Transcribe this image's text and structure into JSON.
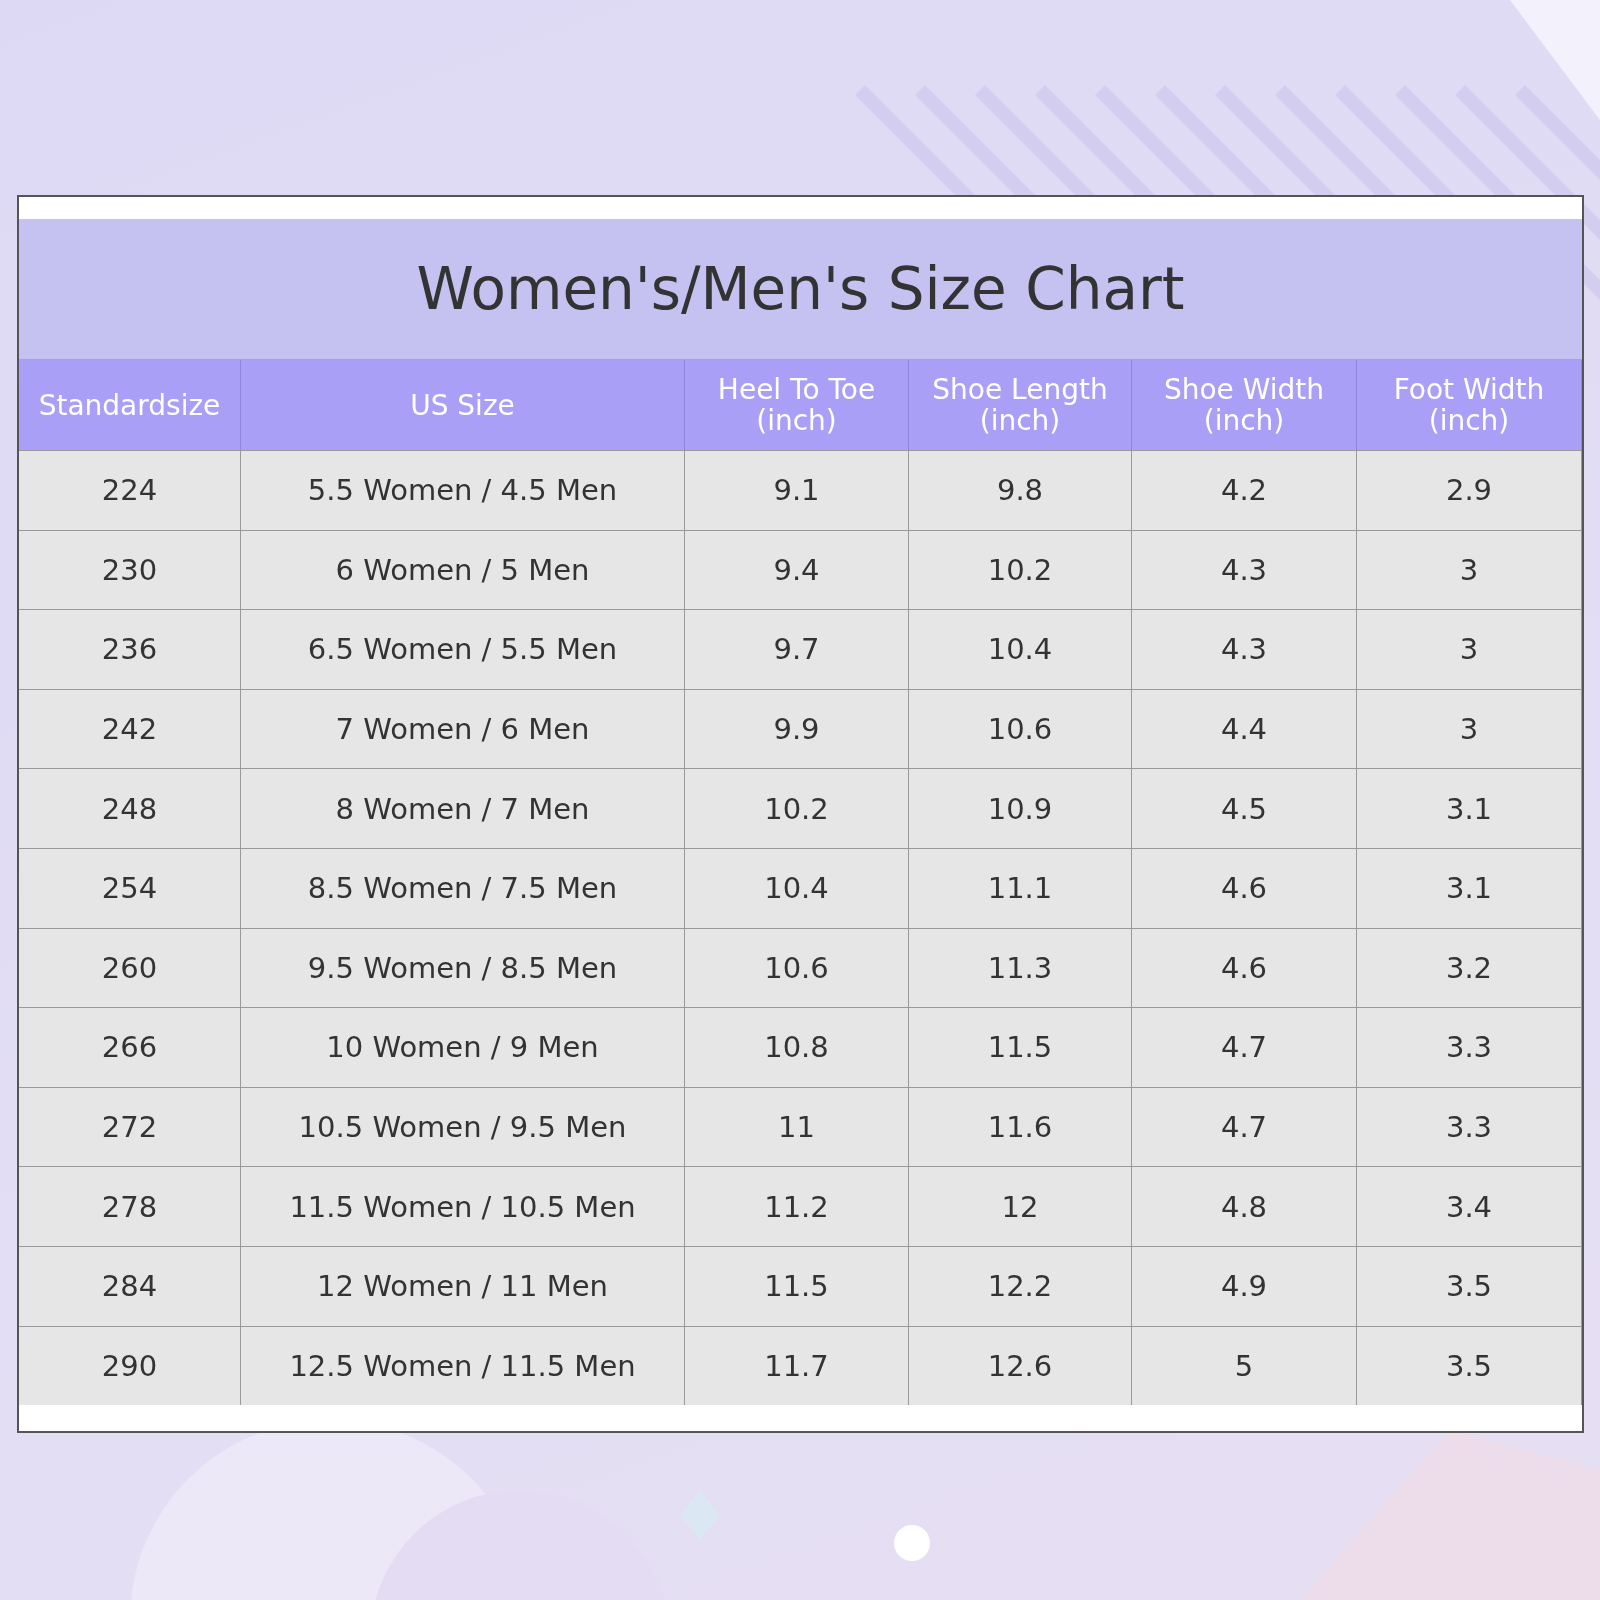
{
  "title": "Women's/Men's Size Chart",
  "table": {
    "columns": [
      "Standardsize",
      "US Size",
      "Heel To Toe\n(inch)",
      "Shoe Length\n(inch)",
      "Shoe Width\n(inch)",
      "Foot Width\n(inch)"
    ],
    "rows": [
      [
        "224",
        "5.5 Women / 4.5 Men",
        "9.1",
        "9.8",
        "4.2",
        "2.9"
      ],
      [
        "230",
        "6 Women / 5 Men",
        "9.4",
        "10.2",
        "4.3",
        "3"
      ],
      [
        "236",
        "6.5 Women / 5.5 Men",
        "9.7",
        "10.4",
        "4.3",
        "3"
      ],
      [
        "242",
        "7 Women / 6 Men",
        "9.9",
        "10.6",
        "4.4",
        "3"
      ],
      [
        "248",
        "8 Women / 7 Men",
        "10.2",
        "10.9",
        "4.5",
        "3.1"
      ],
      [
        "254",
        "8.5 Women / 7.5 Men",
        "10.4",
        "11.1",
        "4.6",
        "3.1"
      ],
      [
        "260",
        "9.5 Women / 8.5 Men",
        "10.6",
        "11.3",
        "4.6",
        "3.2"
      ],
      [
        "266",
        "10 Women / 9 Men",
        "10.8",
        "11.5",
        "4.7",
        "3.3"
      ],
      [
        "272",
        "10.5 Women / 9.5 Men",
        "11",
        "11.6",
        "4.7",
        "3.3"
      ],
      [
        "278",
        "11.5 Women / 10.5 Men",
        "11.2",
        "12",
        "4.8",
        "3.4"
      ],
      [
        "284",
        "12 Women / 11 Men",
        "11.5",
        "12.2",
        "4.9",
        "3.5"
      ],
      [
        "290",
        "12.5 Women / 11.5 Men",
        "11.7",
        "12.6",
        "5",
        "3.5"
      ]
    ]
  }
}
